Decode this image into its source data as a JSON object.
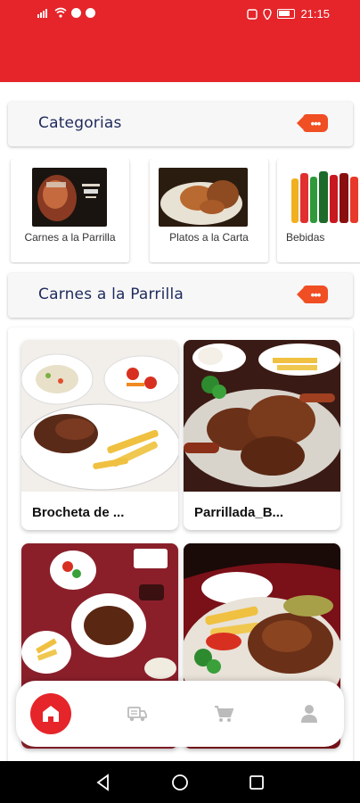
{
  "status_bar": {
    "time": "21:15"
  },
  "colors": {
    "primary": "#e5252a",
    "accent": "#f04e23",
    "title": "#1f2a5c"
  },
  "categories_section": {
    "title": "Categorias",
    "more_icon": "more-arrow-icon"
  },
  "categories": [
    {
      "label": "Carnes a la Parrilla"
    },
    {
      "label": "Platos a la Carta"
    },
    {
      "label": "Bebidas"
    }
  ],
  "products_section": {
    "title": "Carnes a la Parrilla",
    "more_icon": "more-arrow-icon"
  },
  "products": [
    {
      "name": "Brocheta de ..."
    },
    {
      "name": "Parrillada_B..."
    },
    {
      "name": ""
    },
    {
      "name": ""
    }
  ],
  "bottom_nav": [
    {
      "icon": "home-icon",
      "active": true
    },
    {
      "icon": "delivery-truck-icon",
      "active": false
    },
    {
      "icon": "cart-icon",
      "active": false
    },
    {
      "icon": "user-icon",
      "active": false
    }
  ]
}
